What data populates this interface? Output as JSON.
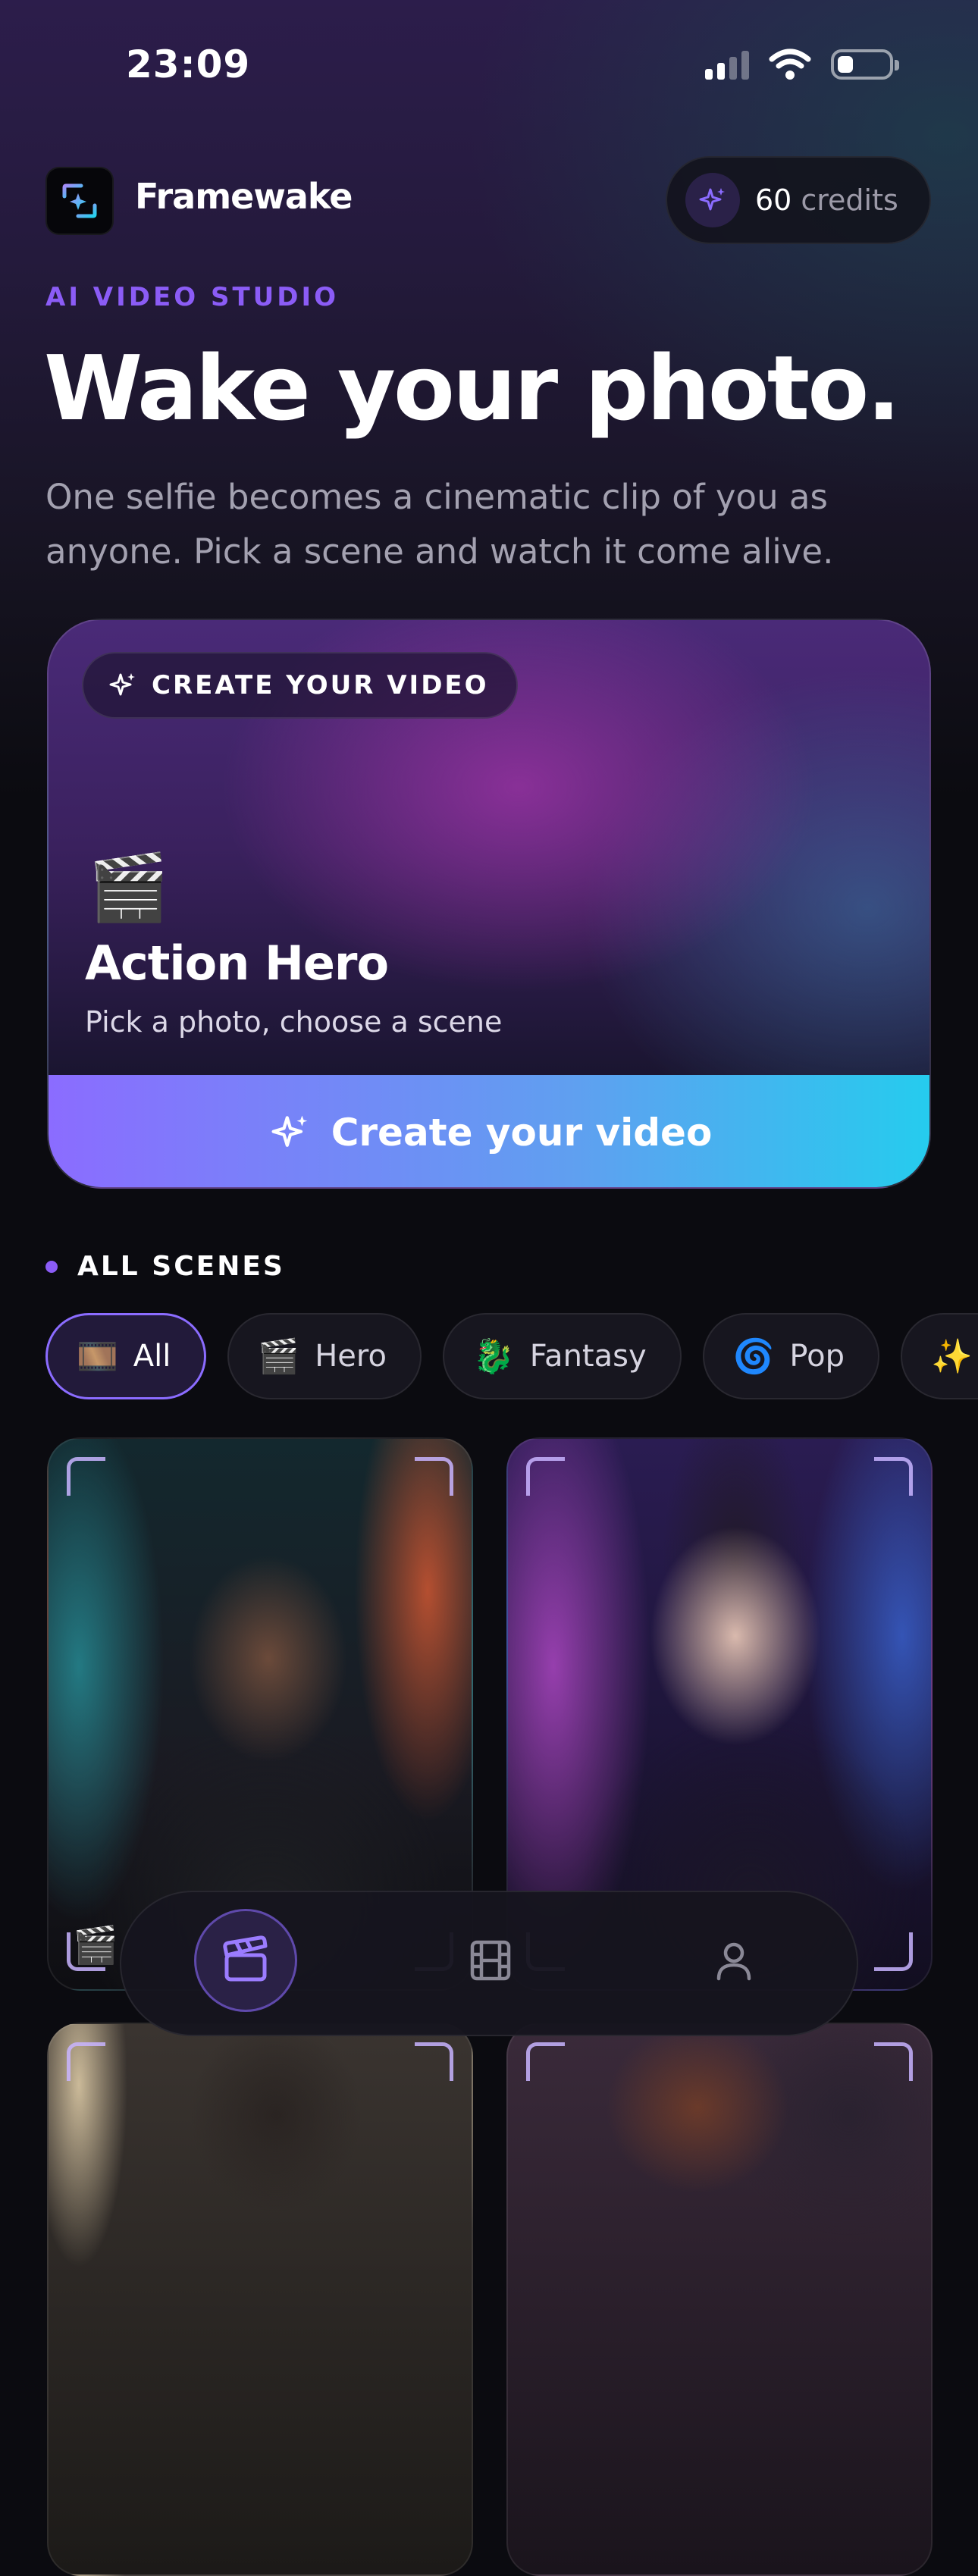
{
  "status_bar": {
    "time": "23:09",
    "icons": [
      "signal-icon",
      "wifi-icon",
      "battery-icon"
    ]
  },
  "header": {
    "app_name": "Framewake",
    "logo_icon": "app-logo-icon",
    "credits_amount": "60",
    "credits_label": "credits",
    "credits_icon": "sparkle-icon"
  },
  "hero": {
    "eyebrow": "AI VIDEO STUDIO",
    "headline": "Wake your photo.",
    "subtext": "One selfie becomes a cinematic clip of you as anyone. Pick a scene and watch it come alive."
  },
  "create_card": {
    "chip_label": "CREATE YOUR VIDEO",
    "scene_emoji": "🎬",
    "scene_title": "Action Hero",
    "scene_subtitle": "Pick a photo, choose a scene",
    "cta_label": "Create your video"
  },
  "scenes": {
    "section_title": "ALL SCENES",
    "filters": [
      {
        "emoji": "🎞️",
        "label": "All",
        "active": true
      },
      {
        "emoji": "🎬",
        "label": "Hero",
        "active": false
      },
      {
        "emoji": "🐉",
        "label": "Fantasy",
        "active": false
      },
      {
        "emoji": "🌀",
        "label": "Pop",
        "active": false
      },
      {
        "emoji": "✨",
        "label": "",
        "active": false
      }
    ],
    "cards": [
      {
        "name": "scene-card-hero-man",
        "badge": "🎬"
      },
      {
        "name": "scene-card-cyberpunk-woman",
        "badge": ""
      },
      {
        "name": "scene-card-noir-man",
        "badge": ""
      },
      {
        "name": "scene-card-vintage-woman",
        "badge": ""
      }
    ]
  },
  "bottom_nav": {
    "items": [
      {
        "icon": "clapperboard-icon",
        "active": true
      },
      {
        "icon": "film-icon",
        "active": false
      },
      {
        "icon": "profile-icon",
        "active": false
      }
    ]
  },
  "colors": {
    "accent": "#8b5cf6",
    "cta_start": "#8b6cff",
    "cta_end": "#25ccee",
    "background": "#0b0b10"
  }
}
